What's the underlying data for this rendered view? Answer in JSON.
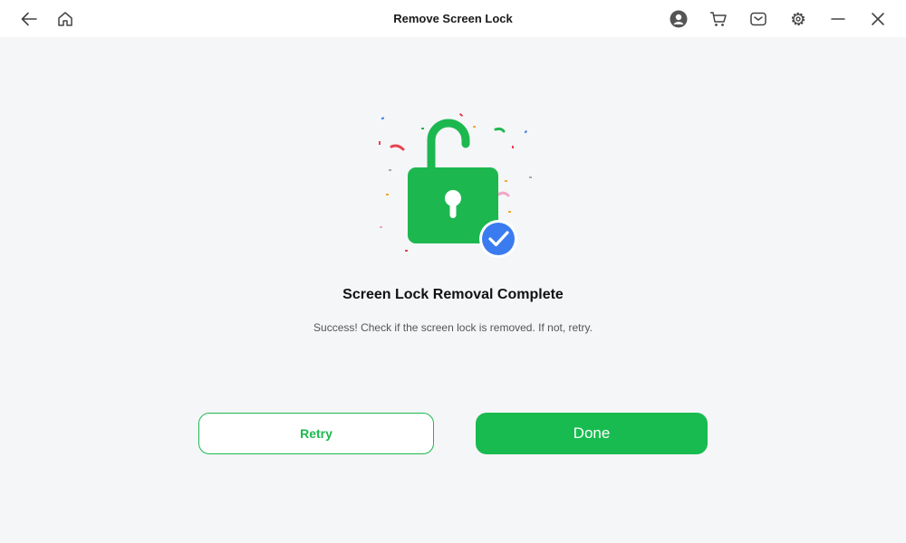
{
  "titlebar": {
    "title": "Remove Screen Lock",
    "icons": [
      "back-arrow-icon",
      "home-icon",
      "account-icon",
      "cart-icon",
      "mail-icon",
      "settings-gear-icon",
      "minimize-icon",
      "close-icon"
    ]
  },
  "result": {
    "heading": "Screen Lock Removal Complete",
    "message": "Success! Check if the screen lock is removed. If not, retry.",
    "illustration": "unlocked-padlock-with-checkmark"
  },
  "actions": {
    "retry_label": "Retry",
    "done_label": "Done"
  },
  "colors": {
    "accent_green": "#18bb4f",
    "check_blue": "#3a7cf0",
    "background": "#f5f6f8"
  }
}
